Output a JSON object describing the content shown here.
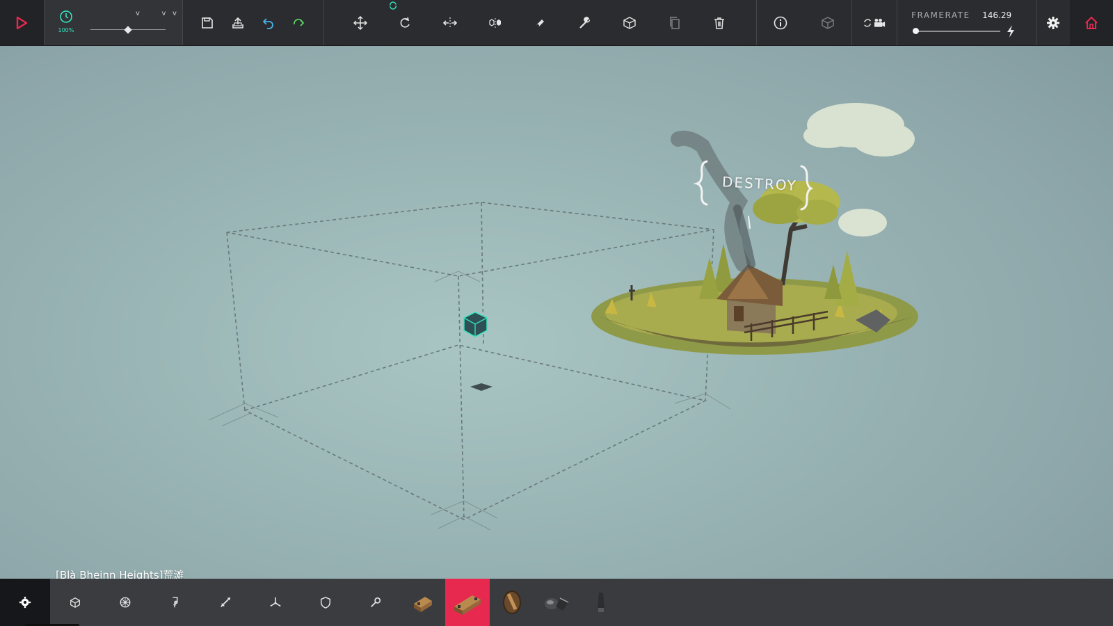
{
  "colors": {
    "accent_red": "#e8294f",
    "accent_teal": "#35e6c0",
    "accent_green": "#56d364",
    "toolbar_bg": "#2b2c2f"
  },
  "toolbar": {
    "play_icon": "play-icon",
    "time_scale_label": "100%",
    "time_scale_level": 0.5,
    "file_icons": [
      "save-icon",
      "load-icon",
      "undo-icon",
      "redo-icon"
    ],
    "tool_icons": [
      "move-icon",
      "rotate-icon",
      "mirror-icon",
      "select-icon",
      "cube-tool-icon",
      "wrench-icon",
      "box-icon",
      "copy-icon",
      "delete-icon"
    ],
    "info_icons": [
      "info-icon",
      "block-info-icon"
    ],
    "camera_icon": "camera-icon",
    "framerate_label": "FRAMERATE",
    "framerate_value": "146.29",
    "framerate_level": 0.0,
    "settings_icon": "gear-icon",
    "home_icon": "home-icon"
  },
  "scene": {
    "destroy_label": "DESTROY"
  },
  "level": {
    "name": "[Blà Bheinn Heights]荒滩"
  },
  "block_categories": [
    {
      "icon": "circle-gear-icon",
      "active": true
    },
    {
      "icon": "cube-icon",
      "active": false
    },
    {
      "icon": "wheel-icon",
      "active": false
    },
    {
      "icon": "hinge-icon",
      "active": false
    },
    {
      "icon": "weapon-icon",
      "active": false
    },
    {
      "icon": "flight-icon",
      "active": false
    },
    {
      "icon": "armor-icon",
      "active": false
    },
    {
      "icon": "tool-icon",
      "active": false
    }
  ],
  "blocks": [
    {
      "name": "small-wooden-block",
      "selected": false
    },
    {
      "name": "wooden-block",
      "selected": true
    },
    {
      "name": "wooden-pole",
      "selected": false
    },
    {
      "name": "ballast",
      "selected": false
    },
    {
      "name": "metal-spike",
      "selected": false
    }
  ]
}
